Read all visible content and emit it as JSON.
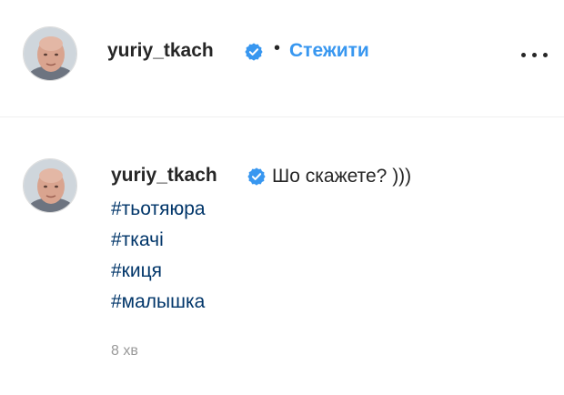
{
  "post_header": {
    "username": "yuriy_tkach",
    "verified_icon": "verified-badge-icon",
    "separator": "•",
    "follow_label": "Стежити",
    "more_icon": "more-options-icon"
  },
  "comment": {
    "username": "yuriy_tkach",
    "text": "Шо скажете? )))",
    "hashtags": [
      "#тьотяюра",
      "#ткачі",
      "#киця",
      "#малышка"
    ],
    "time_ago": "8 хв"
  },
  "colors": {
    "link_blue": "#3897f0",
    "hashtag": "#003569",
    "verified": "#3897f0",
    "muted": "#999999",
    "text": "#262626"
  }
}
